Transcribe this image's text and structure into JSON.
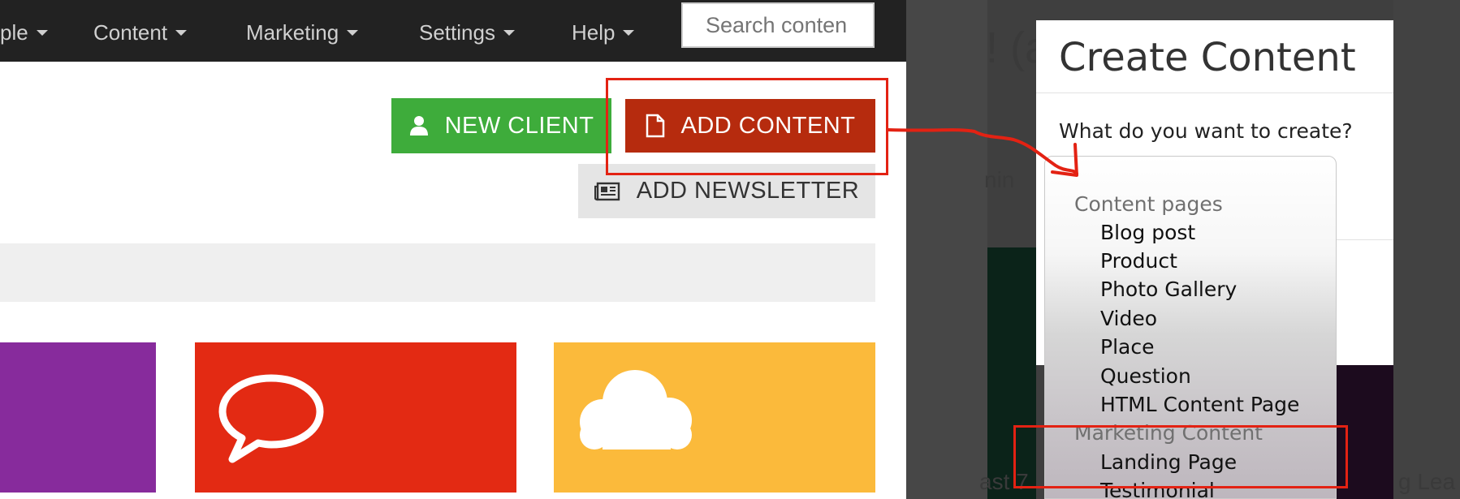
{
  "nav": {
    "items": [
      {
        "label": "ple"
      },
      {
        "label": "Content"
      },
      {
        "label": "Marketing"
      },
      {
        "label": "Settings"
      },
      {
        "label": "Help"
      }
    ],
    "search_placeholder": "Search conten"
  },
  "actions": {
    "new_client": "NEW CLIENT",
    "add_content": "ADD CONTENT",
    "add_newsletter": "ADD NEWSLETTER"
  },
  "background": {
    "heading_fragment": "! (a",
    "text_min": "nin",
    "text_last": "ast 7",
    "text_lea": "g Lea"
  },
  "modal": {
    "title": "Create Content",
    "question": "What do you want to create?",
    "groups": [
      {
        "label": "Content pages",
        "options": [
          "Blog post",
          "Product",
          "Photo Gallery",
          "Video",
          "Place",
          "Question",
          "HTML Content Page"
        ]
      },
      {
        "label": "Marketing Content",
        "options": [
          "Landing Page",
          "Testimonial"
        ]
      }
    ]
  },
  "colors": {
    "navbar": "#222222",
    "new_client": "#3eac3b",
    "add_content": "#b62b0e",
    "tile_purple": "#872b9c",
    "tile_red": "#e32a13",
    "tile_yellow": "#fbba3b",
    "annotation": "#e32213"
  },
  "icons": {
    "new_client": "user-icon",
    "add_content": "document-icon",
    "add_newsletter": "newspaper-icon",
    "tile_red": "speech-bubble-icon",
    "tile_yellow": "cloud-icon"
  }
}
